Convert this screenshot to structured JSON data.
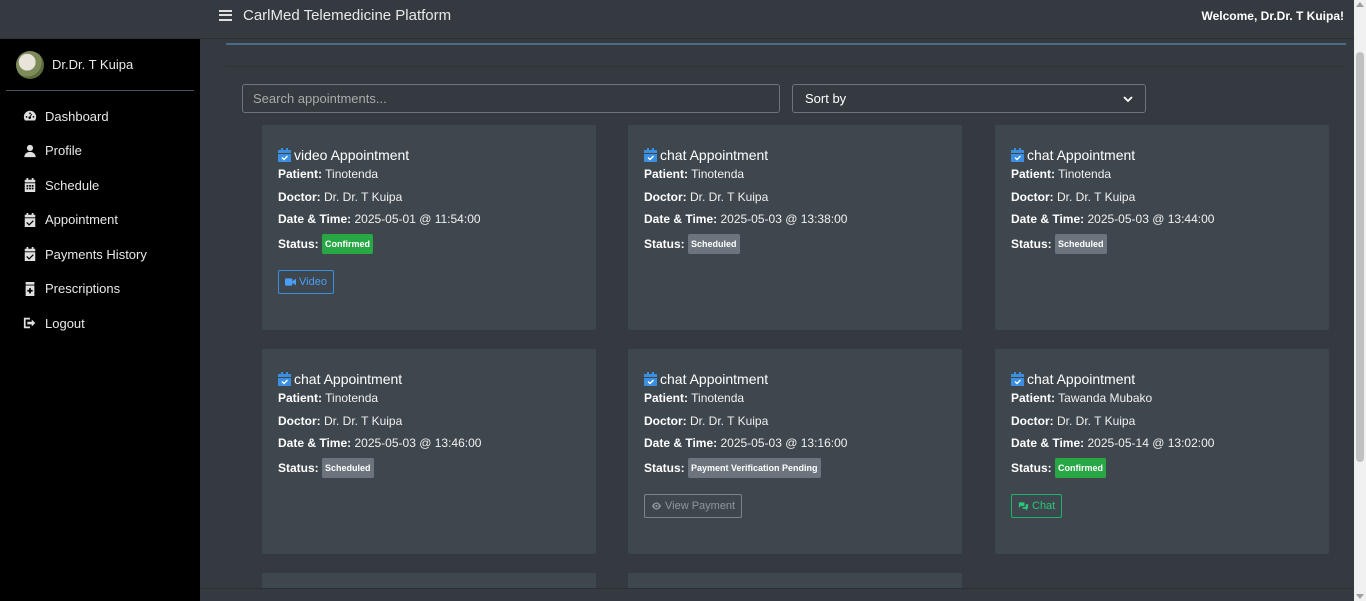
{
  "header": {
    "app_title": "CarlMed Telemedicine Platform",
    "welcome": "Welcome, Dr.Dr. T Kuipa!"
  },
  "sidebar": {
    "user_name": "Dr.Dr. T Kuipa",
    "items": [
      {
        "label": "Dashboard",
        "icon": "dashboard-gauge-icon"
      },
      {
        "label": "Profile",
        "icon": "user-icon"
      },
      {
        "label": "Schedule",
        "icon": "calendar-icon"
      },
      {
        "label": "Appointment",
        "icon": "calendar-check-icon"
      },
      {
        "label": "Payments History",
        "icon": "calendar-check-icon"
      },
      {
        "label": "Prescriptions",
        "icon": "prescription-icon"
      },
      {
        "label": "Logout",
        "icon": "logout-icon"
      }
    ]
  },
  "filters": {
    "search_placeholder": "Search appointments...",
    "sort_label": "Sort by"
  },
  "labels": {
    "patient": "Patient:",
    "doctor": "Doctor:",
    "datetime": "Date & Time:",
    "status": "Status:"
  },
  "colors": {
    "accent_blue": "#3b8ee0",
    "confirmed_green": "#28a745",
    "scheduled_gray": "#6c757d"
  },
  "appointments": [
    {
      "title": "video Appointment",
      "patient": "Tinotenda",
      "doctor": "Dr. Dr. T Kuipa",
      "datetime": "2025-05-01 @ 11:54:00",
      "status": "Confirmed",
      "action": "Video"
    },
    {
      "title": "chat Appointment",
      "patient": "Tinotenda",
      "doctor": "Dr. Dr. T Kuipa",
      "datetime": "2025-05-03 @ 13:38:00",
      "status": "Scheduled",
      "action": ""
    },
    {
      "title": "chat Appointment",
      "patient": "Tinotenda",
      "doctor": "Dr. Dr. T Kuipa",
      "datetime": "2025-05-03 @ 13:44:00",
      "status": "Scheduled",
      "action": ""
    },
    {
      "title": "chat Appointment",
      "patient": "Tinotenda",
      "doctor": "Dr. Dr. T Kuipa",
      "datetime": "2025-05-03 @ 13:46:00",
      "status": "Scheduled",
      "action": ""
    },
    {
      "title": "chat Appointment",
      "patient": "Tinotenda",
      "doctor": "Dr. Dr. T Kuipa",
      "datetime": "2025-05-03 @ 13:16:00",
      "status": "Payment Verification Pending",
      "action": "View Payment"
    },
    {
      "title": "chat Appointment",
      "patient": "Tawanda Mubako",
      "doctor": "Dr. Dr. T Kuipa",
      "datetime": "2025-05-14 @ 13:02:00",
      "status": "Confirmed",
      "action": "Chat"
    }
  ]
}
